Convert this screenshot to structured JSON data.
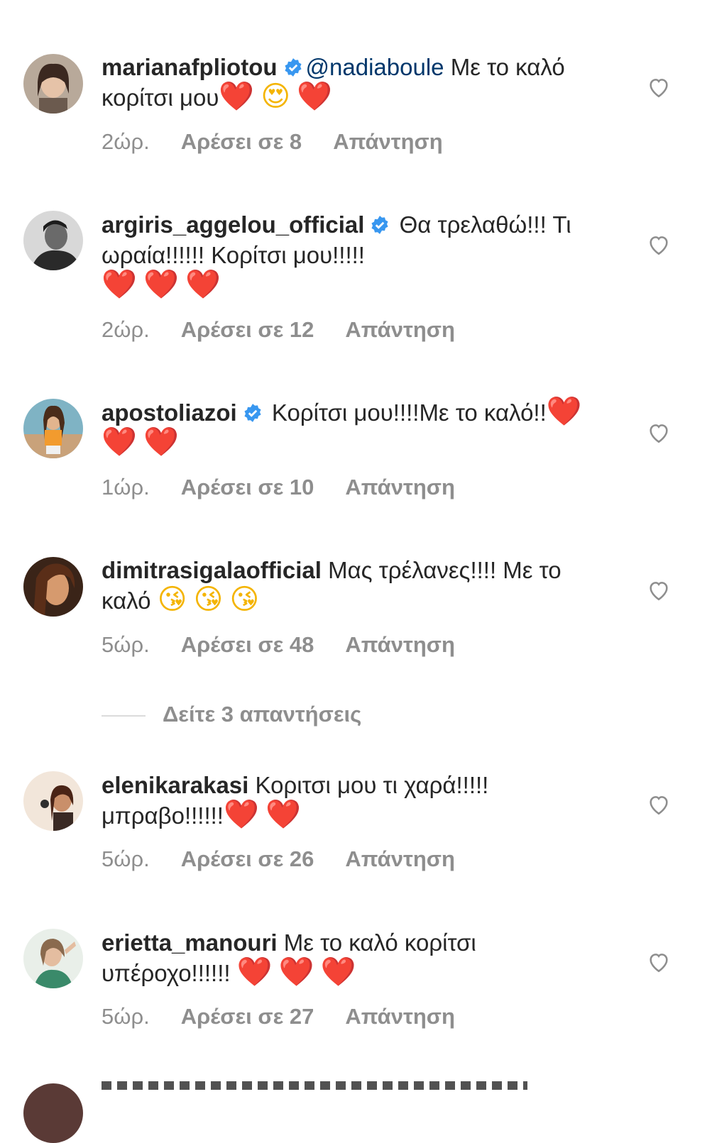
{
  "comments": [
    {
      "username": "marianafpliotou",
      "verified": true,
      "mention": "@nadiaboule",
      "text": " Με το καλό κορίτσι μου",
      "emojis": [
        "❤️",
        "😍",
        "❤️"
      ],
      "time": "2ώρ.",
      "likes": "Αρέσει σε 8",
      "reply": "Απάντηση"
    },
    {
      "username": "argiris_aggelou_official",
      "verified": true,
      "mention": "",
      "text": " Θα τρελαθώ!!! Τι ωραία!!!!!! Κορίτσι μου!!!!!",
      "emojis": [
        "❤️",
        "❤️",
        "❤️"
      ],
      "time": "2ώρ.",
      "likes": "Αρέσει σε 12",
      "reply": "Απάντηση"
    },
    {
      "username": "apostoliazoi",
      "verified": true,
      "mention": "",
      "text": " Κορίτσι μου!!!!Με το καλό!!",
      "emojis": [
        "❤️",
        "❤️",
        "❤️"
      ],
      "time": "1ώρ.",
      "likes": "Αρέσει σε 10",
      "reply": "Απάντηση"
    },
    {
      "username": "dimitrasigalaofficial",
      "verified": false,
      "mention": "",
      "text": " Μας τρέλανες!!!! Με το καλό ",
      "emojis": [
        "😘",
        "😘",
        "😘"
      ],
      "time": "5ώρ.",
      "likes": "Αρέσει σε 48",
      "reply": "Απάντηση"
    },
    {
      "username": "elenikarakasi",
      "verified": false,
      "mention": "",
      "text": " Κοριτσι μου τι χαρά!!!!! μπραβο!!!!!!",
      "emojis": [
        "❤️",
        "❤️"
      ],
      "time": "5ώρ.",
      "likes": "Αρέσει σε 26",
      "reply": "Απάντηση"
    },
    {
      "username": "erietta_manouri",
      "verified": false,
      "mention": "",
      "text": " Με το καλό κορίτσι υπέροχο!!!!!! ",
      "emojis": [
        "❤️",
        "❤️",
        "❤️"
      ],
      "time": "5ώρ.",
      "likes": "Αρέσει σε 27",
      "reply": "Απάντηση"
    }
  ],
  "view_replies": "Δείτε 3 απαντήσεις",
  "colors": {
    "text": "#262626",
    "meta": "#8e8e8e",
    "mention": "#00376b",
    "verified": "#3897f0",
    "heart": "#ee1c25"
  }
}
